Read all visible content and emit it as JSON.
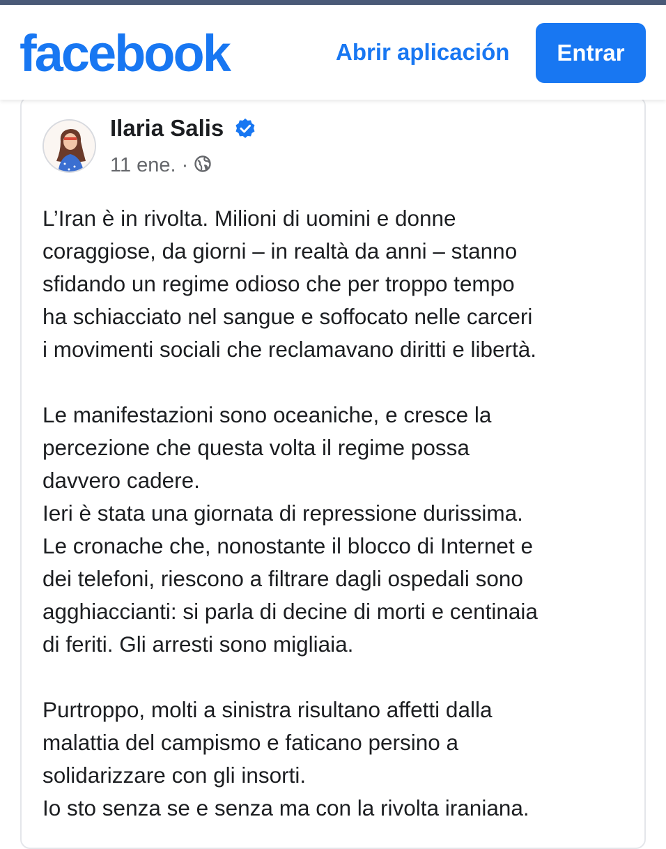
{
  "header": {
    "logo_text": "facebook",
    "open_app_label": "Abrir aplicación",
    "login_label": "Entrar"
  },
  "colors": {
    "brand": "#1877f2",
    "text": "#1c1e21",
    "muted": "#65676b",
    "top_line": "#4a5a78"
  },
  "post": {
    "author": "Ilaria Salis",
    "verified_icon": "verified-badge-icon",
    "date": "11 ene.",
    "separator": "·",
    "audience_icon": "globe-icon",
    "paragraphs": [
      [
        "L’Iran è in rivolta. Milioni di uomini e donne",
        "coraggiose, da giorni – in realtà da anni – stanno",
        "sfidando un regime odioso che per troppo tempo",
        "ha schiacciato nel sangue e soffocato nelle carceri",
        "i movimenti sociali che reclamavano diritti e libertà."
      ],
      [
        "Le manifestazioni sono oceaniche, e cresce la",
        "percezione che questa volta il regime possa",
        "davvero cadere.",
        "Ieri è stata una giornata di repressione durissima.",
        "Le cronache che, nonostante il blocco di Internet e",
        "dei telefoni, riescono a filtrare dagli ospedali sono",
        "agghiaccianti: si parla di decine di morti e centinaia",
        "di feriti. Gli arresti sono migliaia."
      ],
      [
        "Purtroppo, molti a sinistra risultano affetti dalla",
        "malattia del campismo e faticano persino a",
        "solidarizzare con gli insorti.",
        "Io sto senza se e senza ma con la rivolta iraniana."
      ]
    ]
  }
}
